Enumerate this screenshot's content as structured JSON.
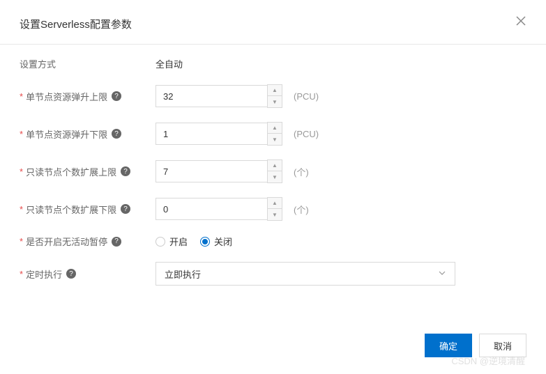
{
  "header": {
    "title": "设置Serverless配置参数"
  },
  "form": {
    "mode": {
      "label": "设置方式",
      "value": "全自动"
    },
    "upperLimit": {
      "label": "单节点资源弹升上限",
      "value": "32",
      "unit": "(PCU)"
    },
    "lowerLimit": {
      "label": "单节点资源弹升下限",
      "value": "1",
      "unit": "(PCU)"
    },
    "roUpper": {
      "label": "只读节点个数扩展上限",
      "value": "7",
      "unit": "(个)"
    },
    "roLower": {
      "label": "只读节点个数扩展下限",
      "value": "0",
      "unit": "(个)"
    },
    "autopause": {
      "label": "是否开启无活动暂停",
      "options": {
        "on": "开启",
        "off": "关闭"
      },
      "selected": "off"
    },
    "schedule": {
      "label": "定时执行",
      "value": "立即执行"
    }
  },
  "footer": {
    "ok": "确定",
    "cancel": "取消"
  },
  "watermark": "CSDN @逆境清醒"
}
